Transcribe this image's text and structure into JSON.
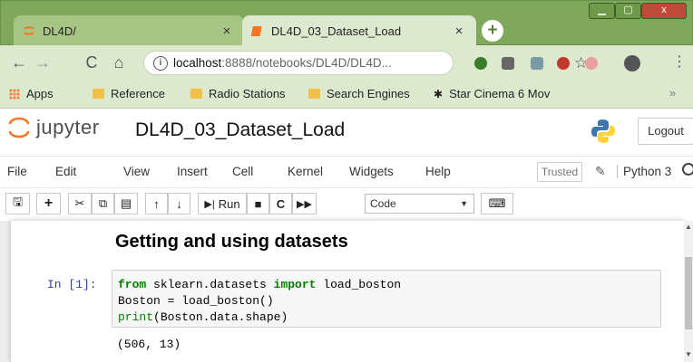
{
  "browser": {
    "tabs": [
      {
        "title": "DL4D/",
        "active": false
      },
      {
        "title": "DL4D_03_Dataset_Load",
        "active": true
      }
    ],
    "close_glyph": "×",
    "new_tab_glyph": "+",
    "window_controls": {
      "minimize": "▁",
      "maximize": "▢",
      "close": "x"
    },
    "url_host": "localhost",
    "url_rest": ":8888/notebooks/DL4D/DL4D...",
    "bookmarks": [
      "Apps",
      "Reference",
      "Radio Stations",
      "Search Engines",
      "Star Cinema 6 Mov"
    ],
    "bookmarks_more": "»",
    "icons": [
      "back-icon",
      "forward-icon",
      "reload-icon",
      "home-icon",
      "info-icon",
      "star-icon",
      "extension-icons",
      "profile-avatar",
      "menu-icon"
    ]
  },
  "jupyter": {
    "logo_text": "jupyter",
    "notebook_name": "DL4D_03_Dataset_Load",
    "logout_label": "Logout",
    "menus": [
      "File",
      "Edit",
      "View",
      "Insert",
      "Cell",
      "Kernel",
      "Widgets",
      "Help"
    ],
    "trusted_label": "Trusted",
    "kernel_name": "Python 3",
    "toolbar": {
      "run_label": "Run",
      "cell_type": "Code"
    },
    "cells": {
      "heading": "Getting and using datasets",
      "prompt": "In [1]:",
      "code": {
        "line1_kw1": "from",
        "line1_mid": " sklearn.datasets ",
        "line1_kw2": "import",
        "line1_end": " load_boston",
        "line2": "Boston = load_boston()",
        "line3_fn": "print",
        "line3_rest": "(Boston.data.shape)"
      },
      "output": "(506, 13)"
    }
  },
  "colors": {
    "frame": "#7fa85a",
    "toolbar_bg": "#dde9cf",
    "prompt": "#303f9f",
    "keyword": "#008000"
  }
}
